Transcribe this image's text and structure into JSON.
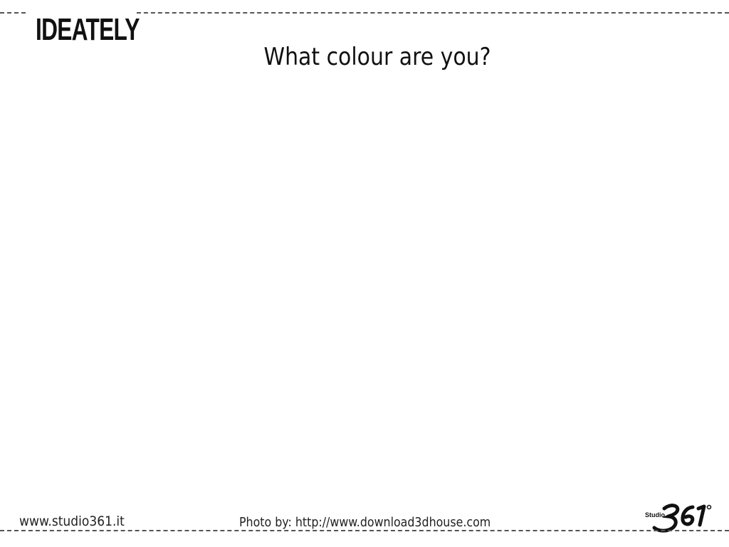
{
  "brand": {
    "logo_text": "IDEATELY"
  },
  "slide": {
    "title": "What colour are you?"
  },
  "footer": {
    "website": "www.studio361.it",
    "photo_credit": "Photo by: http://www.download3dhouse.com",
    "studio_logo_text": "Studio 361°"
  }
}
